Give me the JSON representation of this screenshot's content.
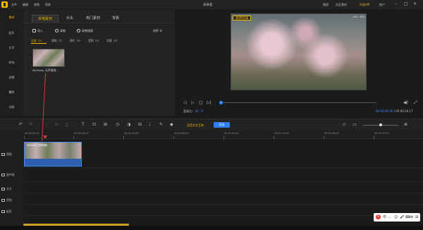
{
  "app": {
    "title": "未命名",
    "menu": [
      "文件",
      "编辑",
      "视频",
      "帮助"
    ],
    "right_links": [
      "教程",
      "社区素材",
      "升级VIP",
      "账户"
    ],
    "window_controls": [
      "minimize-icon",
      "maximize-icon",
      "close-icon"
    ],
    "last_saved": "上次保存 10:19"
  },
  "sidebar": {
    "items": [
      "素材",
      "配乐",
      "文字",
      "转场",
      "滤镜",
      "叠附",
      "动画"
    ]
  },
  "media": {
    "tabs": [
      "本地素材",
      "片头",
      "热门素材",
      "背景"
    ],
    "tools": {
      "import": "导入",
      "record": "录制",
      "screen_record": "录制镜面",
      "sort": "排序"
    },
    "filters": [
      "全部（1）",
      "视频（1）",
      "图片（0）",
      "音频（0）",
      "字幕（0）"
    ],
    "file_name": "MyVideo_无声视频..."
  },
  "preview": {
    "badge": "爱转剪辑",
    "corner": "480 · 480",
    "ratio_label": "宽高比：",
    "ratio_value": "16：9",
    "time_current": "00:00:00.00",
    "time_total": "/ 00:00:18.17",
    "controls": [
      "prev-frame-icon",
      "play-icon",
      "stop-icon",
      "next-frame-icon"
    ],
    "right_controls": [
      "volume-icon",
      "fullscreen-icon"
    ]
  },
  "timeline": {
    "text_tools_label": "语音文字互转",
    "export_label": "导出",
    "ruler": [
      "00:00:00.00",
      "00:00:16.00",
      "00:00:32.00",
      "00:00:48.00",
      "00:01:04.00",
      "00:01:20.00",
      "00:01:36.00",
      "00:01:52.00"
    ],
    "tracks": [
      "视频",
      "画中画",
      "文字",
      "音频",
      "配音"
    ],
    "clip_label": "MyVideo_无声视频"
  },
  "tray": {
    "brand": "S",
    "items": [
      "中",
      "·,",
      "☺",
      "🎤",
      "⌨",
      "⚙",
      "⊞"
    ]
  }
}
